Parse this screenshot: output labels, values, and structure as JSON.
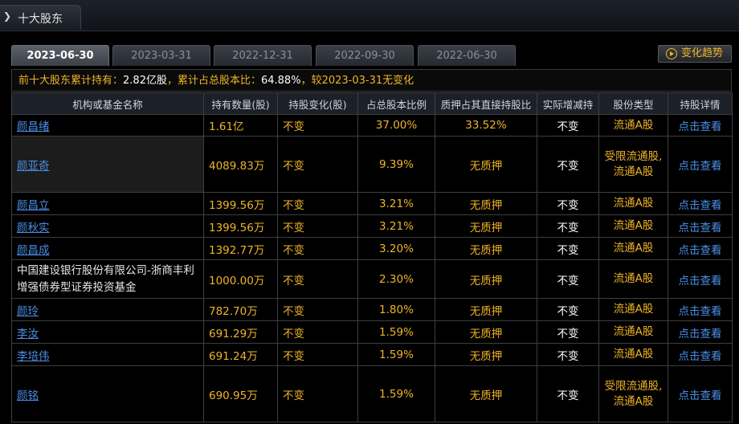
{
  "section": {
    "title": "十大股东"
  },
  "tabs": [
    "2023-06-30",
    "2023-03-31",
    "2022-12-31",
    "2022-09-30",
    "2022-06-30"
  ],
  "active_tab": 0,
  "trend_button": {
    "label": "变化趋势",
    "icon": "play-circle-icon"
  },
  "summary": {
    "prefix": "前十大股东累计持有：",
    "shares": "2.82亿股",
    "mid": "，累计占总股本比：",
    "ratio": "64.88%",
    "suffix": "，较2023-03-31无变化"
  },
  "table": {
    "headers": [
      "机构或基金名称",
      "持有数量(股)",
      "持股变化(股)",
      "占总股本比例",
      "质押占其直接持股比",
      "实际增减持",
      "股份类型",
      "持股详情"
    ],
    "rows": [
      {
        "name": "颜昌绪",
        "link": true,
        "qty": "1.61亿",
        "change": "不变",
        "pct": "37.00%",
        "pledge": "33.52%",
        "actual": "不变",
        "type": "流通A股",
        "detail": "点击查看"
      },
      {
        "name": "颜亚奇",
        "link": true,
        "qty": "4089.83万",
        "change": "不变",
        "pct": "9.39%",
        "pledge": "无质押",
        "actual": "不变",
        "type": "受限流通股,流通A股",
        "detail": "点击查看"
      },
      {
        "name": "颜昌立",
        "link": true,
        "qty": "1399.56万",
        "change": "不变",
        "pct": "3.21%",
        "pledge": "无质押",
        "actual": "不变",
        "type": "流通A股",
        "detail": "点击查看"
      },
      {
        "name": "颜秋实",
        "link": true,
        "qty": "1399.56万",
        "change": "不变",
        "pct": "3.21%",
        "pledge": "无质押",
        "actual": "不变",
        "type": "流通A股",
        "detail": "点击查看"
      },
      {
        "name": "颜昌成",
        "link": true,
        "qty": "1392.77万",
        "change": "不变",
        "pct": "3.20%",
        "pledge": "无质押",
        "actual": "不变",
        "type": "流通A股",
        "detail": "点击查看"
      },
      {
        "name": "中国建设银行股份有限公司-浙商丰利增强债券型证券投资基金",
        "link": false,
        "qty": "1000.00万",
        "change": "不变",
        "pct": "2.30%",
        "pledge": "无质押",
        "actual": "不变",
        "type": "流通A股",
        "detail": "点击查看"
      },
      {
        "name": "颜玲",
        "link": true,
        "qty": "782.70万",
        "change": "不变",
        "pct": "1.80%",
        "pledge": "无质押",
        "actual": "不变",
        "type": "流通A股",
        "detail": "点击查看"
      },
      {
        "name": "李汝",
        "link": true,
        "qty": "691.29万",
        "change": "不变",
        "pct": "1.59%",
        "pledge": "无质押",
        "actual": "不变",
        "type": "流通A股",
        "detail": "点击查看"
      },
      {
        "name": "李培伟",
        "link": true,
        "qty": "691.24万",
        "change": "不变",
        "pct": "1.59%",
        "pledge": "无质押",
        "actual": "不变",
        "type": "流通A股",
        "detail": "点击查看"
      },
      {
        "name": "颜铭",
        "link": true,
        "qty": "690.95万",
        "change": "不变",
        "pct": "1.59%",
        "pledge": "无质押",
        "actual": "不变",
        "type": "受限流通股,流通A股",
        "detail": "点击查看"
      }
    ]
  },
  "colors": {
    "accent": "#f0b428",
    "link": "#4b8fe8",
    "background": "#000000"
  }
}
